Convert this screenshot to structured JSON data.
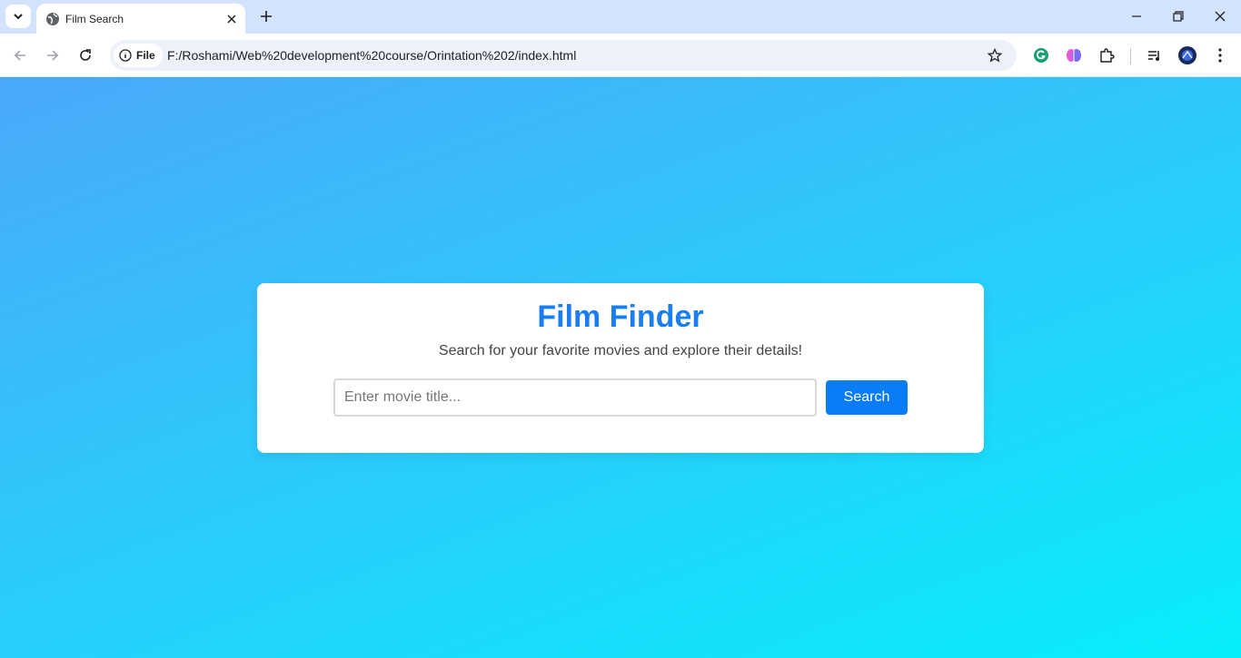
{
  "browser": {
    "tab_title": "Film Search",
    "address_chip": "File",
    "url": "F:/Roshami/Web%20development%20course/Orintation%202/index.html"
  },
  "page": {
    "title": "Film Finder",
    "subtitle": "Search for your favorite movies and explore their details!",
    "search_placeholder": "Enter movie title...",
    "search_button": "Search"
  },
  "colors": {
    "title": "#1a7ef0",
    "button": "#0a7df6",
    "gradient_start": "#4aa8fb",
    "gradient_end": "#06eefa"
  },
  "icons": {
    "tab_search": "chevron-down-icon",
    "favicon": "globe-icon",
    "tab_close": "close-icon",
    "new_tab": "plus-icon",
    "back": "arrow-left-icon",
    "forward": "arrow-right-icon",
    "reload": "reload-icon",
    "site_info": "info-icon",
    "bookmark": "star-icon",
    "extensions": [
      "grammarly-icon",
      "brain-icon",
      "puzzle-icon"
    ],
    "media": "media-control-icon",
    "profile": "profile-avatar-icon",
    "menu": "kebab-menu-icon"
  }
}
